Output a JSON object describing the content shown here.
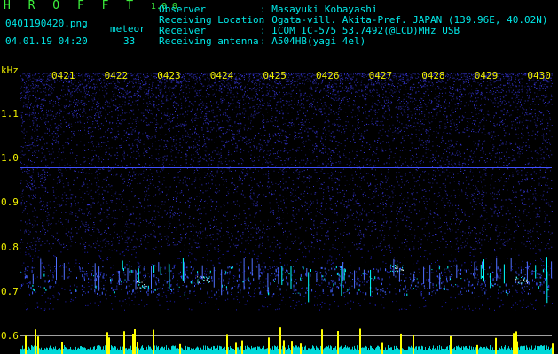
{
  "header": {
    "app_name": "H R O F F T",
    "version": "1.0.0",
    "filename": "0401190420.png",
    "meteor_label": "meteor",
    "datetime": "04.01.19 04:20",
    "meteor_count": "33"
  },
  "info": [
    {
      "label": "Observer",
      "value": ": Masayuki Kobayashi"
    },
    {
      "label": "Receiving Location",
      "value": ": Ogata-vill. Akita-Pref. JAPAN (139.96E, 40.02N)"
    },
    {
      "label": "Receiver",
      "value": ": ICOM IC-575 53.7492(@LCD)MHz USB"
    },
    {
      "label": "Receiving antenna",
      "value": ": A504HB(yagi 4el)"
    }
  ],
  "axis": {
    "unit": "kHz",
    "y_ticks": [
      "1.1",
      "1.0",
      "0.9",
      "0.8",
      "0.7",
      "0.6"
    ],
    "x_ticks": [
      "0421",
      "0422",
      "0423",
      "0424",
      "0425",
      "0426",
      "0427",
      "0428",
      "0429",
      "0430"
    ]
  },
  "colors": {
    "background": "#000000",
    "noise": "#2a2aff",
    "meteor": "#00ffff",
    "ping": "#ffff00",
    "ref_line": "#a0a0a0"
  }
}
